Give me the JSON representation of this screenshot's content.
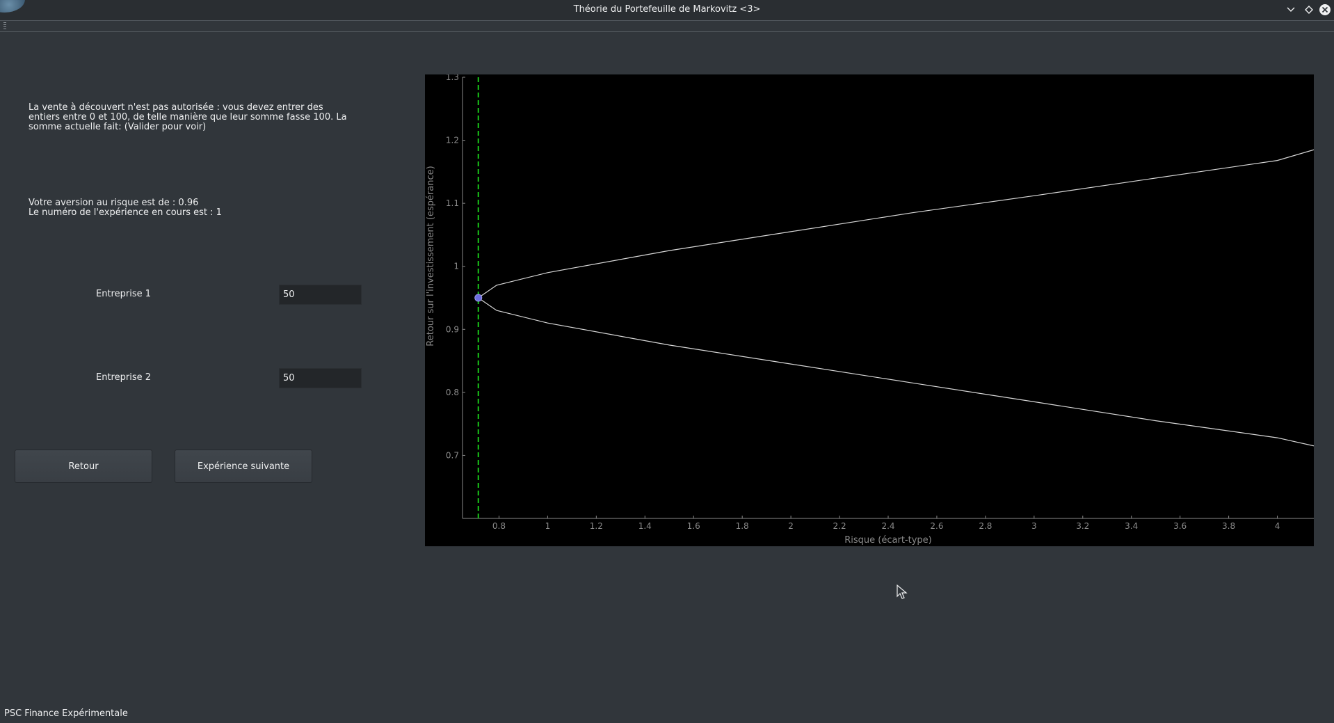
{
  "window": {
    "title": "Théorie du Portefeuille de Markovitz <3>",
    "icons": [
      "chevron-down-icon",
      "diamond-maximize-icon",
      "close-circle-icon"
    ]
  },
  "info": {
    "short_selling": "La vente à découvert n'est pas autorisée : vous devez entrer des entiers entre 0 et 100, de telle manière que leur somme fasse 100. La somme actuelle fait: (Valider pour voir)",
    "risk_aversion": "Votre aversion au risque est de : 0.96",
    "experiment_number": "Le numéro de l'expérience en cours est : 1"
  },
  "form": {
    "company1_label": "Entreprise 1",
    "company1_value": "50",
    "company2_label": "Entreprise 2",
    "company2_value": "50"
  },
  "buttons": {
    "back": "Retour",
    "next": "Expérience suivante"
  },
  "status_bar": "PSC Finance Expérimentale",
  "colors": {
    "background": "#31363b",
    "plot_background": "#000000",
    "curve": "#d8d8d8",
    "risk_line": "#19c619",
    "marker": "#6d6de0"
  },
  "chart_data": {
    "type": "line",
    "xlabel": "Risque (écart-type)",
    "ylabel": "Retour sur l'investissement (espérance)",
    "xlim": [
      0.65,
      4.15
    ],
    "ylim": [
      0.6,
      1.3
    ],
    "x_ticks": [
      "0.8",
      "1",
      "1.2",
      "1.4",
      "1.6",
      "1.8",
      "2",
      "2.2",
      "2.4",
      "2.6",
      "2.8",
      "3",
      "3.2",
      "3.4",
      "3.6",
      "3.8",
      "4"
    ],
    "y_ticks": [
      "0.7",
      "0.8",
      "0.9",
      "1",
      "1.1",
      "1.2",
      "1.3"
    ],
    "series": [
      {
        "values": [
          [
            0.715,
            0.95
          ],
          [
            0.79,
            0.97
          ],
          [
            1.0,
            0.99
          ],
          [
            1.5,
            1.025
          ],
          [
            2.0,
            1.055
          ],
          [
            2.5,
            1.085
          ],
          [
            3.0,
            1.112
          ],
          [
            3.5,
            1.14
          ],
          [
            4.0,
            1.168
          ],
          [
            4.15,
            1.185
          ]
        ]
      },
      {
        "values": [
          [
            0.715,
            0.95
          ],
          [
            0.79,
            0.93
          ],
          [
            1.0,
            0.91
          ],
          [
            1.5,
            0.875
          ],
          [
            2.0,
            0.845
          ],
          [
            2.5,
            0.815
          ],
          [
            3.0,
            0.785
          ],
          [
            3.5,
            0.755
          ],
          [
            4.0,
            0.728
          ],
          [
            4.15,
            0.715
          ]
        ]
      }
    ],
    "vertical_line_x": 0.715,
    "marker_point": [
      0.715,
      0.95
    ],
    "grid": false
  }
}
